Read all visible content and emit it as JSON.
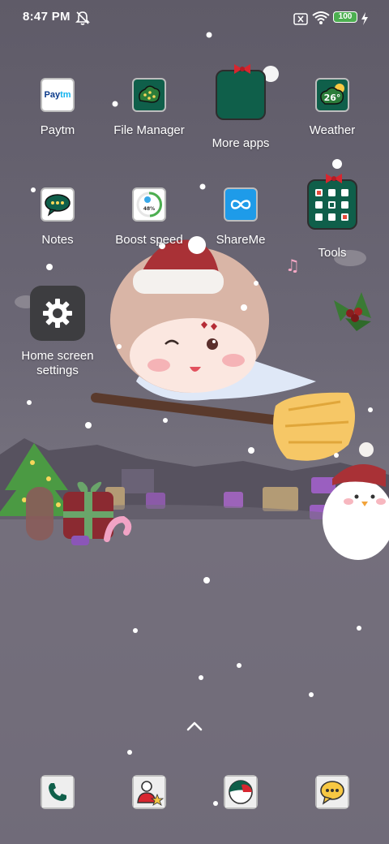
{
  "status_bar": {
    "time": "8:47 PM",
    "icons": [
      "alarm-off-icon",
      "sim-error-icon",
      "wifi-icon",
      "battery-icon",
      "charging-icon"
    ],
    "battery_level": "100"
  },
  "home": {
    "apps": [
      {
        "label": "Paytm",
        "icon": "paytm-icon",
        "icon_text_a": "Pay",
        "icon_text_b": "tm"
      },
      {
        "label": "File Manager",
        "icon": "file-manager-icon"
      },
      {
        "label": "More apps",
        "icon": "folder-icon"
      },
      {
        "label": "Weather",
        "icon": "weather-icon",
        "temperature": "26°"
      },
      {
        "label": "Notes",
        "icon": "notes-icon"
      },
      {
        "label": "Boost speed",
        "icon": "boost-speed-icon",
        "percent": "48%"
      },
      {
        "label": "ShareMe",
        "icon": "shareme-icon"
      },
      {
        "label": "Tools",
        "icon": "folder-icon"
      },
      {
        "label": "Home screen settings",
        "icon": "gear-icon"
      }
    ]
  },
  "dock": {
    "items": [
      {
        "name": "phone",
        "icon": "phone-icon"
      },
      {
        "name": "contacts",
        "icon": "contacts-icon"
      },
      {
        "name": "browser",
        "icon": "browser-icon"
      },
      {
        "name": "messaging",
        "icon": "messaging-icon"
      }
    ]
  },
  "colors": {
    "folder_green": "#0f5f4a",
    "battery_green": "#4caf50",
    "shareme_blue": "#1e9be9"
  }
}
